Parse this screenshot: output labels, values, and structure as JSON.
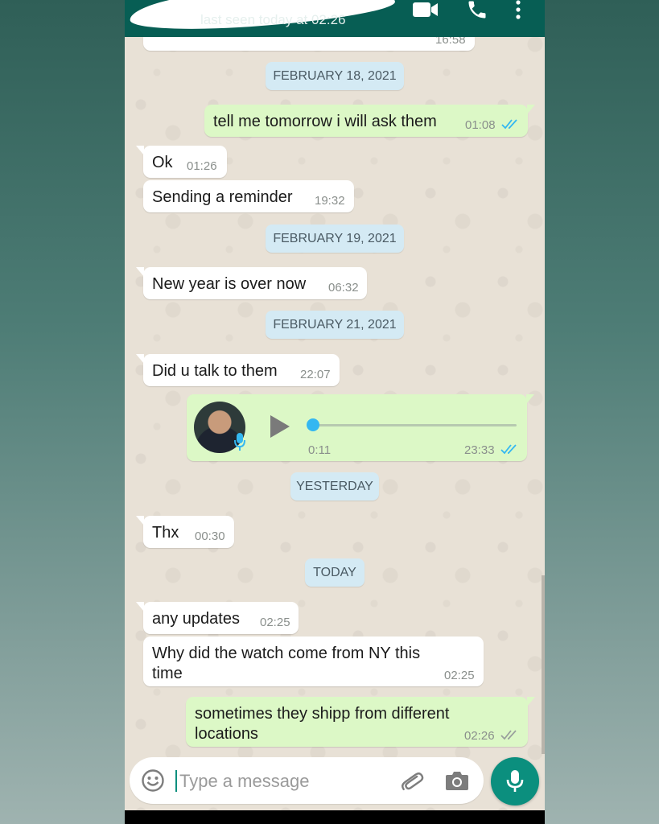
{
  "header": {
    "last_seen": "last seen today at 02:26",
    "icons": [
      "video-call-icon",
      "voice-call-icon",
      "more-options-icon"
    ]
  },
  "messages": {
    "prev": {
      "time": "16:58"
    },
    "date_feb18": "FEBRUARY 18, 2021",
    "m1": {
      "text": "tell me tomorrow i will ask them",
      "time": "01:08"
    },
    "m2": {
      "text": "Ok",
      "time": "01:26"
    },
    "m3": {
      "text": "Sending a reminder",
      "time": "19:32"
    },
    "date_feb19": "FEBRUARY 19, 2021",
    "m4": {
      "text": "New year is over now",
      "time": "06:32"
    },
    "date_feb21": "FEBRUARY 21, 2021",
    "m5": {
      "text": "Did u talk to them",
      "time": "22:07"
    },
    "voice": {
      "duration": "0:11",
      "time": "23:33",
      "progress": 0
    },
    "date_yesterday": "YESTERDAY",
    "m6": {
      "text": "Thx",
      "time": "00:30"
    },
    "date_today": "TODAY",
    "m7": {
      "text": "any updates",
      "time": "02:25"
    },
    "m8": {
      "text_line1": "Why did the watch come from NY this",
      "text_line2": "time",
      "time": "02:25"
    },
    "m9": {
      "text_line1": "sometimes they shipp from different",
      "text_line2": "locations",
      "time": "02:26"
    }
  },
  "composer": {
    "placeholder": "Type a message",
    "value": ""
  },
  "colors": {
    "header": "#075e54",
    "outgoing": "#dcf8c6",
    "incoming": "#ffffff",
    "accent": "#0b8f7e",
    "read_ticks": "#34b7f1"
  }
}
